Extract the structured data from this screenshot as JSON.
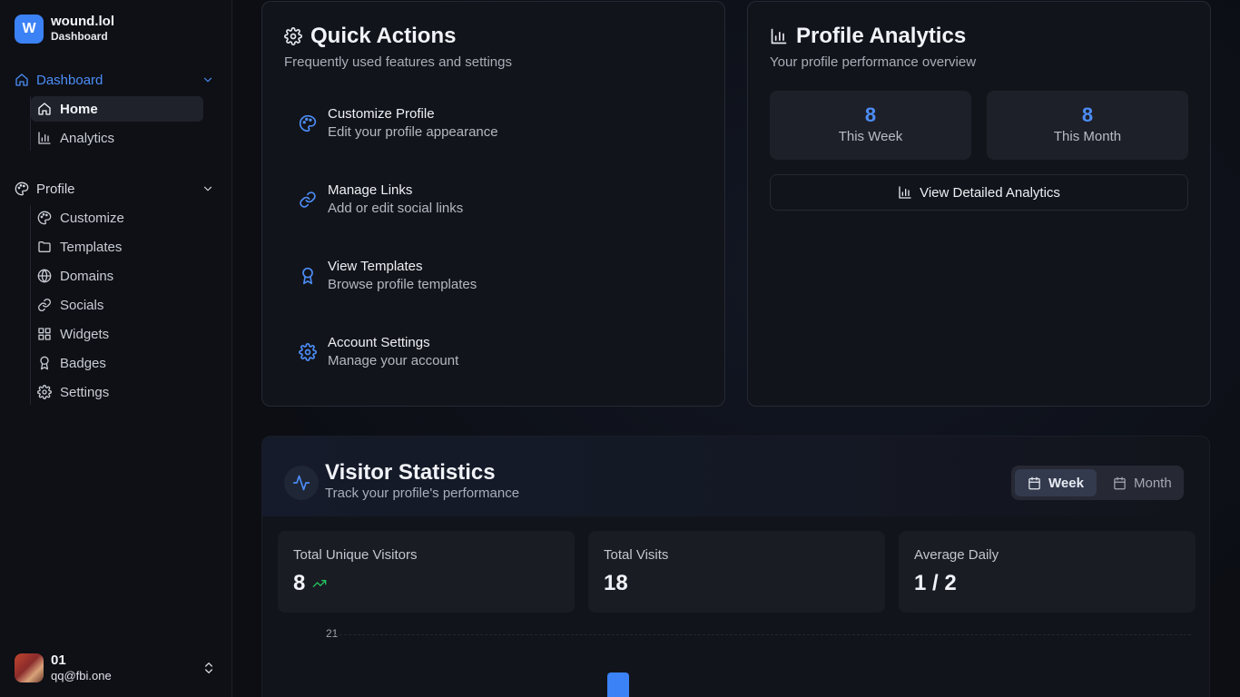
{
  "brand": {
    "logo_letter": "W",
    "name": "wound.lol",
    "subtitle": "Dashboard"
  },
  "sidebar": {
    "groups": [
      {
        "label": "Dashboard",
        "icon": "house-icon",
        "active": true,
        "items": [
          {
            "label": "Home",
            "icon": "house-icon",
            "active": true
          },
          {
            "label": "Analytics",
            "icon": "bar-chart-icon"
          }
        ]
      },
      {
        "label": "Profile",
        "icon": "palette-icon",
        "items": [
          {
            "label": "Customize",
            "icon": "palette-icon"
          },
          {
            "label": "Templates",
            "icon": "folder-icon"
          },
          {
            "label": "Domains",
            "icon": "globe-icon"
          },
          {
            "label": "Socials",
            "icon": "link-icon"
          },
          {
            "label": "Widgets",
            "icon": "grid-icon"
          },
          {
            "label": "Badges",
            "icon": "award-icon"
          },
          {
            "label": "Settings",
            "icon": "gear-icon"
          }
        ]
      }
    ]
  },
  "user": {
    "name": "01",
    "email": "qq@fbi.one"
  },
  "quick_actions": {
    "title": "Quick Actions",
    "description": "Frequently used features and settings",
    "items": [
      {
        "label": "Customize Profile",
        "desc": "Edit your profile appearance",
        "icon": "palette-icon"
      },
      {
        "label": "Manage Links",
        "desc": "Add or edit social links",
        "icon": "link-icon"
      },
      {
        "label": "View Templates",
        "desc": "Browse profile templates",
        "icon": "award-icon"
      },
      {
        "label": "Account Settings",
        "desc": "Manage your account",
        "icon": "gear-icon"
      }
    ]
  },
  "profile_analytics": {
    "title": "Profile Analytics",
    "description": "Your profile performance overview",
    "week": {
      "value": "8",
      "label": "This Week"
    },
    "month": {
      "value": "8",
      "label": "This Month"
    },
    "button_label": "View Detailed Analytics"
  },
  "visitor_stats": {
    "title": "Visitor Statistics",
    "description": "Track your profile's performance",
    "toggle": {
      "week": "Week",
      "month": "Month",
      "selected": "Week"
    },
    "stats": [
      {
        "label": "Total Unique Visitors",
        "value": "8",
        "trend": "up"
      },
      {
        "label": "Total Visits",
        "value": "18"
      },
      {
        "label": "Average Daily",
        "value": "1 / 2"
      }
    ],
    "chart_top_tick": "21"
  },
  "colors": {
    "accent": "#3b82f6",
    "trend_up": "#22c55e"
  }
}
